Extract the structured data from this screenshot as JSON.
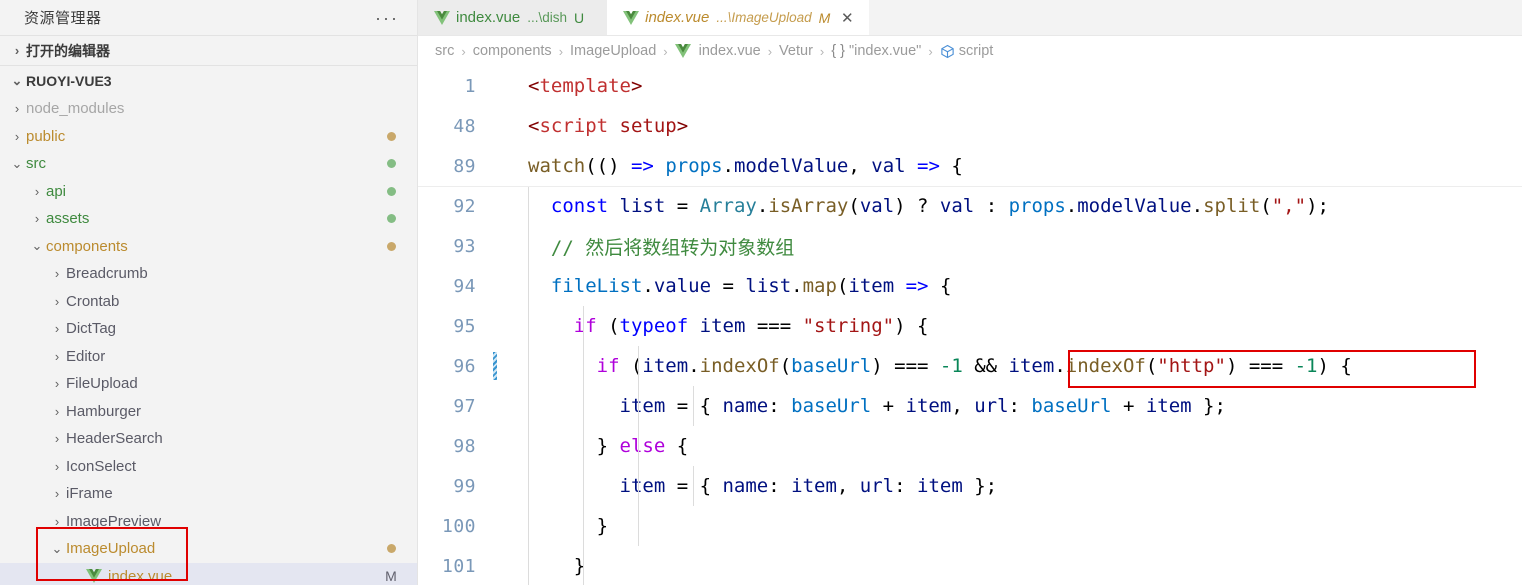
{
  "sidebar": {
    "header_title": "资源管理器",
    "more_icon": "ellipsis-icon",
    "sections": [
      {
        "label": "打开的编辑器",
        "expanded": false
      },
      {
        "label": "RUOYI-VUE3",
        "expanded": true
      }
    ],
    "tree": [
      {
        "label": "node_modules",
        "indent": 1,
        "twisty": "collapsed",
        "style": "dim",
        "badge": "",
        "dot": ""
      },
      {
        "label": "public",
        "indent": 1,
        "twisty": "collapsed",
        "style": "mod",
        "badge": "",
        "dot": "#c9a86a"
      },
      {
        "label": "src",
        "indent": 1,
        "twisty": "expanded",
        "style": "unt",
        "badge": "",
        "dot": "#84bd84"
      },
      {
        "label": "api",
        "indent": 2,
        "twisty": "collapsed",
        "style": "unt",
        "badge": "",
        "dot": "#84bd84"
      },
      {
        "label": "assets",
        "indent": 2,
        "twisty": "collapsed",
        "style": "unt",
        "badge": "",
        "dot": "#84bd84"
      },
      {
        "label": "components",
        "indent": 2,
        "twisty": "expanded",
        "style": "mod",
        "badge": "",
        "dot": "#c9a86a"
      },
      {
        "label": "Breadcrumb",
        "indent": 3,
        "twisty": "collapsed",
        "style": "plain",
        "badge": "",
        "dot": ""
      },
      {
        "label": "Crontab",
        "indent": 3,
        "twisty": "collapsed",
        "style": "plain",
        "badge": "",
        "dot": ""
      },
      {
        "label": "DictTag",
        "indent": 3,
        "twisty": "collapsed",
        "style": "plain",
        "badge": "",
        "dot": ""
      },
      {
        "label": "Editor",
        "indent": 3,
        "twisty": "collapsed",
        "style": "plain",
        "badge": "",
        "dot": ""
      },
      {
        "label": "FileUpload",
        "indent": 3,
        "twisty": "collapsed",
        "style": "plain",
        "badge": "",
        "dot": ""
      },
      {
        "label": "Hamburger",
        "indent": 3,
        "twisty": "collapsed",
        "style": "plain",
        "badge": "",
        "dot": ""
      },
      {
        "label": "HeaderSearch",
        "indent": 3,
        "twisty": "collapsed",
        "style": "plain",
        "badge": "",
        "dot": ""
      },
      {
        "label": "IconSelect",
        "indent": 3,
        "twisty": "collapsed",
        "style": "plain",
        "badge": "",
        "dot": ""
      },
      {
        "label": "iFrame",
        "indent": 3,
        "twisty": "collapsed",
        "style": "plain",
        "badge": "",
        "dot": ""
      },
      {
        "label": "ImagePreview",
        "indent": 3,
        "twisty": "collapsed",
        "style": "plain",
        "badge": "",
        "dot": ""
      },
      {
        "label": "ImageUpload",
        "indent": 3,
        "twisty": "expanded",
        "style": "mod",
        "badge": "",
        "dot": "#c9a86a"
      },
      {
        "label": "index.vue",
        "indent": 4,
        "twisty": "none",
        "icon": "vue-icon",
        "style": "mod",
        "badge": "M",
        "dot": "",
        "selected": true
      }
    ]
  },
  "tabs": [
    {
      "icon": "vue-icon",
      "name": "index.vue",
      "path": "...\\dish",
      "status": "U",
      "active": false,
      "closable": false
    },
    {
      "icon": "vue-icon",
      "name": "index.vue",
      "path": "...\\ImageUpload",
      "status": "M",
      "active": true,
      "closable": true,
      "close_icon": "close-icon"
    }
  ],
  "breadcrumb": [
    {
      "label": "src",
      "icon": ""
    },
    {
      "label": "components",
      "icon": ""
    },
    {
      "label": "ImageUpload",
      "icon": ""
    },
    {
      "label": "index.vue",
      "icon": "vue-icon"
    },
    {
      "label": "Vetur",
      "icon": ""
    },
    {
      "label": "\"index.vue\"",
      "icon": "braces-icon"
    },
    {
      "label": "script",
      "icon": "cube-icon"
    }
  ],
  "code": {
    "lines": [
      {
        "num": "1",
        "folded": true,
        "dirty": false,
        "indents": 0,
        "tokens": [
          {
            "t": "<",
            "c": "t-tag"
          },
          {
            "t": "template",
            "c": "t-tag2"
          },
          {
            "t": ">",
            "c": "t-tag"
          }
        ]
      },
      {
        "num": "48",
        "folded": true,
        "dirty": false,
        "indents": 0,
        "tokens": [
          {
            "t": "<",
            "c": "t-tag"
          },
          {
            "t": "script",
            "c": "t-tag2"
          },
          {
            "t": " ",
            "c": "t-plain"
          },
          {
            "t": "setup",
            "c": "t-str"
          },
          {
            "t": ">",
            "c": "t-tag"
          }
        ]
      },
      {
        "num": "89",
        "folded": true,
        "dirty": false,
        "indents": 0,
        "tokens": [
          {
            "t": "watch",
            "c": "t-fn"
          },
          {
            "t": "(() ",
            "c": "t-op"
          },
          {
            "t": "=>",
            "c": "t-kw"
          },
          {
            "t": " ",
            "c": "t-op"
          },
          {
            "t": "props",
            "c": "t-prop"
          },
          {
            "t": ".",
            "c": "t-op"
          },
          {
            "t": "modelValue",
            "c": "t-var"
          },
          {
            "t": ", ",
            "c": "t-op"
          },
          {
            "t": "val",
            "c": "t-var"
          },
          {
            "t": " ",
            "c": "t-op"
          },
          {
            "t": "=>",
            "c": "t-kw"
          },
          {
            "t": " {",
            "c": "t-op"
          }
        ]
      },
      {
        "num": "92",
        "folded": false,
        "dirty": false,
        "indents": 1,
        "tokens": [
          {
            "t": "  ",
            "c": "t-op"
          },
          {
            "t": "const",
            "c": "t-kw"
          },
          {
            "t": " ",
            "c": "t-op"
          },
          {
            "t": "list",
            "c": "t-var"
          },
          {
            "t": " = ",
            "c": "t-op"
          },
          {
            "t": "Array",
            "c": "t-cls"
          },
          {
            "t": ".",
            "c": "t-op"
          },
          {
            "t": "isArray",
            "c": "t-fn"
          },
          {
            "t": "(",
            "c": "t-op"
          },
          {
            "t": "val",
            "c": "t-var"
          },
          {
            "t": ") ? ",
            "c": "t-op"
          },
          {
            "t": "val",
            "c": "t-var"
          },
          {
            "t": " : ",
            "c": "t-op"
          },
          {
            "t": "props",
            "c": "t-prop"
          },
          {
            "t": ".",
            "c": "t-op"
          },
          {
            "t": "modelValue",
            "c": "t-var"
          },
          {
            "t": ".",
            "c": "t-op"
          },
          {
            "t": "split",
            "c": "t-fn"
          },
          {
            "t": "(",
            "c": "t-op"
          },
          {
            "t": "\",\"",
            "c": "t-str"
          },
          {
            "t": ");",
            "c": "t-op"
          }
        ]
      },
      {
        "num": "93",
        "folded": false,
        "dirty": false,
        "indents": 1,
        "tokens": [
          {
            "t": "  ",
            "c": "t-op"
          },
          {
            "t": "// 然后将数组转为对象数组",
            "c": "t-com"
          }
        ]
      },
      {
        "num": "94",
        "folded": false,
        "dirty": false,
        "indents": 1,
        "tokens": [
          {
            "t": "  ",
            "c": "t-op"
          },
          {
            "t": "fileList",
            "c": "t-prop"
          },
          {
            "t": ".",
            "c": "t-op"
          },
          {
            "t": "value",
            "c": "t-var"
          },
          {
            "t": " = ",
            "c": "t-op"
          },
          {
            "t": "list",
            "c": "t-var"
          },
          {
            "t": ".",
            "c": "t-op"
          },
          {
            "t": "map",
            "c": "t-fn"
          },
          {
            "t": "(",
            "c": "t-op"
          },
          {
            "t": "item",
            "c": "t-var"
          },
          {
            "t": " ",
            "c": "t-op"
          },
          {
            "t": "=>",
            "c": "t-kw"
          },
          {
            "t": " {",
            "c": "t-op"
          }
        ]
      },
      {
        "num": "95",
        "folded": false,
        "dirty": false,
        "indents": 2,
        "tokens": [
          {
            "t": "    ",
            "c": "t-op"
          },
          {
            "t": "if",
            "c": "t-kw2"
          },
          {
            "t": " (",
            "c": "t-op"
          },
          {
            "t": "typeof",
            "c": "t-kw"
          },
          {
            "t": " ",
            "c": "t-op"
          },
          {
            "t": "item",
            "c": "t-var"
          },
          {
            "t": " === ",
            "c": "t-op"
          },
          {
            "t": "\"string\"",
            "c": "t-str"
          },
          {
            "t": ") {",
            "c": "t-op"
          }
        ]
      },
      {
        "num": "96",
        "folded": false,
        "dirty": true,
        "indents": 3,
        "tokens": [
          {
            "t": "      ",
            "c": "t-op"
          },
          {
            "t": "if",
            "c": "t-kw2"
          },
          {
            "t": " (",
            "c": "t-op"
          },
          {
            "t": "item",
            "c": "t-var"
          },
          {
            "t": ".",
            "c": "t-op"
          },
          {
            "t": "indexOf",
            "c": "t-fn"
          },
          {
            "t": "(",
            "c": "t-op"
          },
          {
            "t": "baseUrl",
            "c": "t-prop"
          },
          {
            "t": ") === ",
            "c": "t-op"
          },
          {
            "t": "-1",
            "c": "t-num"
          },
          {
            "t": " && ",
            "c": "t-op"
          },
          {
            "t": "item",
            "c": "t-var"
          },
          {
            "t": ".",
            "c": "t-op"
          },
          {
            "t": "indexOf",
            "c": "t-fn"
          },
          {
            "t": "(",
            "c": "t-op"
          },
          {
            "t": "\"http\"",
            "c": "t-str"
          },
          {
            "t": ") === ",
            "c": "t-op"
          },
          {
            "t": "-1",
            "c": "t-num"
          },
          {
            "t": ") {",
            "c": "t-op"
          }
        ]
      },
      {
        "num": "97",
        "folded": false,
        "dirty": false,
        "indents": 4,
        "tokens": [
          {
            "t": "        ",
            "c": "t-op"
          },
          {
            "t": "item",
            "c": "t-var"
          },
          {
            "t": " = { ",
            "c": "t-op"
          },
          {
            "t": "name",
            "c": "t-var"
          },
          {
            "t": ": ",
            "c": "t-op"
          },
          {
            "t": "baseUrl",
            "c": "t-prop"
          },
          {
            "t": " + ",
            "c": "t-op"
          },
          {
            "t": "item",
            "c": "t-var"
          },
          {
            "t": ", ",
            "c": "t-op"
          },
          {
            "t": "url",
            "c": "t-var"
          },
          {
            "t": ": ",
            "c": "t-op"
          },
          {
            "t": "baseUrl",
            "c": "t-prop"
          },
          {
            "t": " + ",
            "c": "t-op"
          },
          {
            "t": "item",
            "c": "t-var"
          },
          {
            "t": " };",
            "c": "t-op"
          }
        ]
      },
      {
        "num": "98",
        "folded": false,
        "dirty": false,
        "indents": 3,
        "tokens": [
          {
            "t": "      } ",
            "c": "t-op"
          },
          {
            "t": "else",
            "c": "t-kw2"
          },
          {
            "t": " {",
            "c": "t-op"
          }
        ]
      },
      {
        "num": "99",
        "folded": false,
        "dirty": false,
        "indents": 4,
        "tokens": [
          {
            "t": "        ",
            "c": "t-op"
          },
          {
            "t": "item",
            "c": "t-var"
          },
          {
            "t": " = { ",
            "c": "t-op"
          },
          {
            "t": "name",
            "c": "t-var"
          },
          {
            "t": ": ",
            "c": "t-op"
          },
          {
            "t": "item",
            "c": "t-var"
          },
          {
            "t": ", ",
            "c": "t-op"
          },
          {
            "t": "url",
            "c": "t-var"
          },
          {
            "t": ": ",
            "c": "t-op"
          },
          {
            "t": "item",
            "c": "t-var"
          },
          {
            "t": " };",
            "c": "t-op"
          }
        ]
      },
      {
        "num": "100",
        "folded": false,
        "dirty": false,
        "indents": 3,
        "tokens": [
          {
            "t": "      }",
            "c": "t-op"
          }
        ]
      },
      {
        "num": "101",
        "folded": false,
        "dirty": false,
        "indents": 2,
        "tokens": [
          {
            "t": "    }",
            "c": "t-op"
          }
        ]
      }
    ]
  },
  "colors": {
    "highlight_box": "#e00000",
    "modified_badge": "#bb8b2e",
    "untracked": "#3f8a3f",
    "selection_bg": "#e4e6f1",
    "dirty_gutter": "#3794cf"
  }
}
